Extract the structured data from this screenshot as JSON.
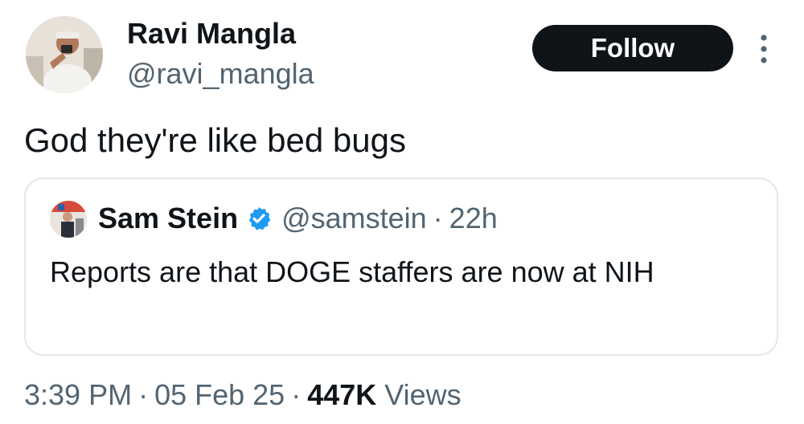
{
  "author": {
    "name": "Ravi Mangla",
    "handle": "@ravi_mangla"
  },
  "follow_label": "Follow",
  "more_icon": "more-vertical-icon",
  "tweet_text": "God they're like bed bugs",
  "quoted": {
    "name": "Sam Stein",
    "verified_icon": "verified-badge-icon",
    "handle": "@samstein",
    "separator": "·",
    "time": "22h",
    "text": "Reports are that DOGE staffers are now at NIH"
  },
  "meta": {
    "time": "3:39 PM",
    "sep1": "·",
    "date": "05 Feb 25",
    "sep2": "·",
    "views_count": "447K",
    "views_label": "Views"
  },
  "colors": {
    "text": "#0f1419",
    "secondary": "#536471",
    "follow_bg": "#0f1419",
    "verified": "#1d9bf0",
    "border": "#e1e8ed"
  }
}
